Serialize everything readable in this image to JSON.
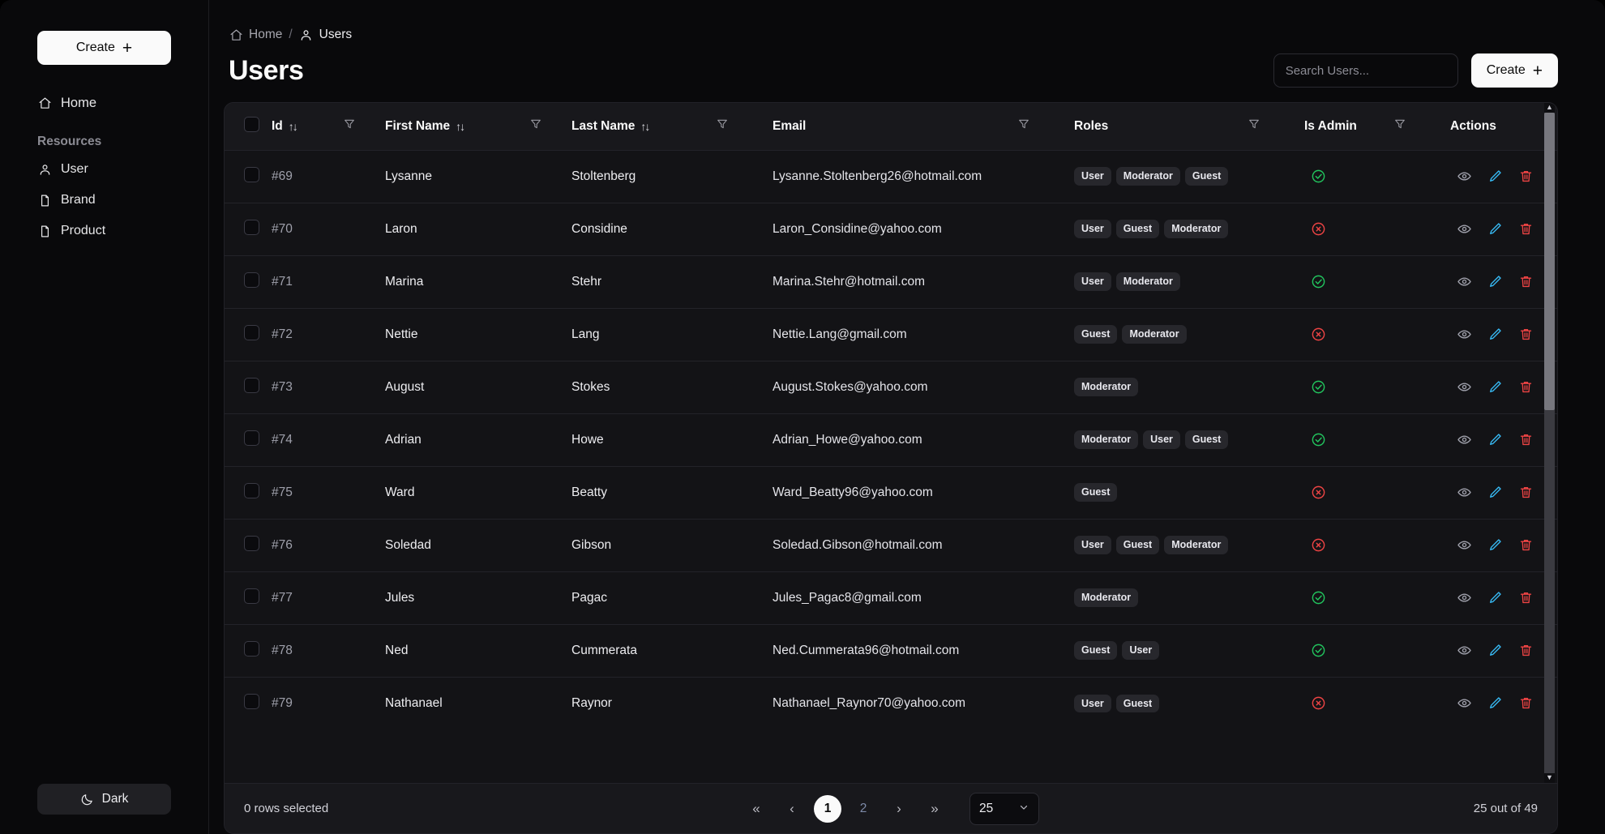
{
  "sidebar": {
    "create_label": "Create",
    "home_label": "Home",
    "resources_label": "Resources",
    "resources": [
      {
        "label": "User",
        "icon": "user-icon"
      },
      {
        "label": "Brand",
        "icon": "file-icon"
      },
      {
        "label": "Product",
        "icon": "file-icon"
      }
    ],
    "theme_toggle_label": "Dark"
  },
  "breadcrumb": {
    "home": "Home",
    "separator": "/",
    "current": "Users"
  },
  "header": {
    "title": "Users",
    "search_placeholder": "Search Users...",
    "search_value": "",
    "create_label": "Create"
  },
  "table": {
    "columns": [
      {
        "key": "id",
        "label": "Id",
        "sortable": true,
        "filterable": true
      },
      {
        "key": "first_name",
        "label": "First Name",
        "sortable": true,
        "filterable": true
      },
      {
        "key": "last_name",
        "label": "Last Name",
        "sortable": true,
        "filterable": true
      },
      {
        "key": "email",
        "label": "Email",
        "sortable": false,
        "filterable": true
      },
      {
        "key": "roles",
        "label": "Roles",
        "sortable": false,
        "filterable": true
      },
      {
        "key": "is_admin",
        "label": "Is Admin",
        "sortable": false,
        "filterable": true
      },
      {
        "key": "actions",
        "label": "Actions",
        "sortable": false,
        "filterable": false
      }
    ],
    "sort_icon": "↑↓",
    "rows": [
      {
        "id": "#69",
        "first_name": "Lysanne",
        "last_name": "Stoltenberg",
        "email": "Lysanne.Stoltenberg26@hotmail.com",
        "roles": [
          "User",
          "Moderator",
          "Guest"
        ],
        "is_admin": true
      },
      {
        "id": "#70",
        "first_name": "Laron",
        "last_name": "Considine",
        "email": "Laron_Considine@yahoo.com",
        "roles": [
          "User",
          "Guest",
          "Moderator"
        ],
        "is_admin": false
      },
      {
        "id": "#71",
        "first_name": "Marina",
        "last_name": "Stehr",
        "email": "Marina.Stehr@hotmail.com",
        "roles": [
          "User",
          "Moderator"
        ],
        "is_admin": true
      },
      {
        "id": "#72",
        "first_name": "Nettie",
        "last_name": "Lang",
        "email": "Nettie.Lang@gmail.com",
        "roles": [
          "Guest",
          "Moderator"
        ],
        "is_admin": false
      },
      {
        "id": "#73",
        "first_name": "August",
        "last_name": "Stokes",
        "email": "August.Stokes@yahoo.com",
        "roles": [
          "Moderator"
        ],
        "is_admin": true
      },
      {
        "id": "#74",
        "first_name": "Adrian",
        "last_name": "Howe",
        "email": "Adrian_Howe@yahoo.com",
        "roles": [
          "Moderator",
          "User",
          "Guest"
        ],
        "is_admin": true
      },
      {
        "id": "#75",
        "first_name": "Ward",
        "last_name": "Beatty",
        "email": "Ward_Beatty96@yahoo.com",
        "roles": [
          "Guest"
        ],
        "is_admin": false
      },
      {
        "id": "#76",
        "first_name": "Soledad",
        "last_name": "Gibson",
        "email": "Soledad.Gibson@hotmail.com",
        "roles": [
          "User",
          "Guest",
          "Moderator"
        ],
        "is_admin": false
      },
      {
        "id": "#77",
        "first_name": "Jules",
        "last_name": "Pagac",
        "email": "Jules_Pagac8@gmail.com",
        "roles": [
          "Moderator"
        ],
        "is_admin": true
      },
      {
        "id": "#78",
        "first_name": "Ned",
        "last_name": "Cummerata",
        "email": "Ned.Cummerata96@hotmail.com",
        "roles": [
          "Guest",
          "User"
        ],
        "is_admin": true
      },
      {
        "id": "#79",
        "first_name": "Nathanael",
        "last_name": "Raynor",
        "email": "Nathanael_Raynor70@yahoo.com",
        "roles": [
          "User",
          "Guest"
        ],
        "is_admin": false
      }
    ],
    "row_actions": [
      {
        "name": "view-action",
        "icon": "eye-icon"
      },
      {
        "name": "edit-action",
        "icon": "pencil-icon"
      },
      {
        "name": "delete-action",
        "icon": "trash-icon"
      }
    ]
  },
  "footer": {
    "rows_selected": "0 rows selected",
    "pager": {
      "first": "«",
      "prev": "‹",
      "pages": [
        "1",
        "2"
      ],
      "active_page": "1",
      "next": "›",
      "last": "»"
    },
    "per_page_value": "25",
    "count_label": "25 out of 49"
  },
  "colors": {
    "accent_white": "#fafafa",
    "bg": "#09090b",
    "card": "#131316",
    "header_row": "#18181c",
    "badge": "#27272c",
    "success": "#22c55e",
    "danger": "#ef4444",
    "edit_blue": "#38bdf8",
    "muted": "#9fa0ab"
  }
}
